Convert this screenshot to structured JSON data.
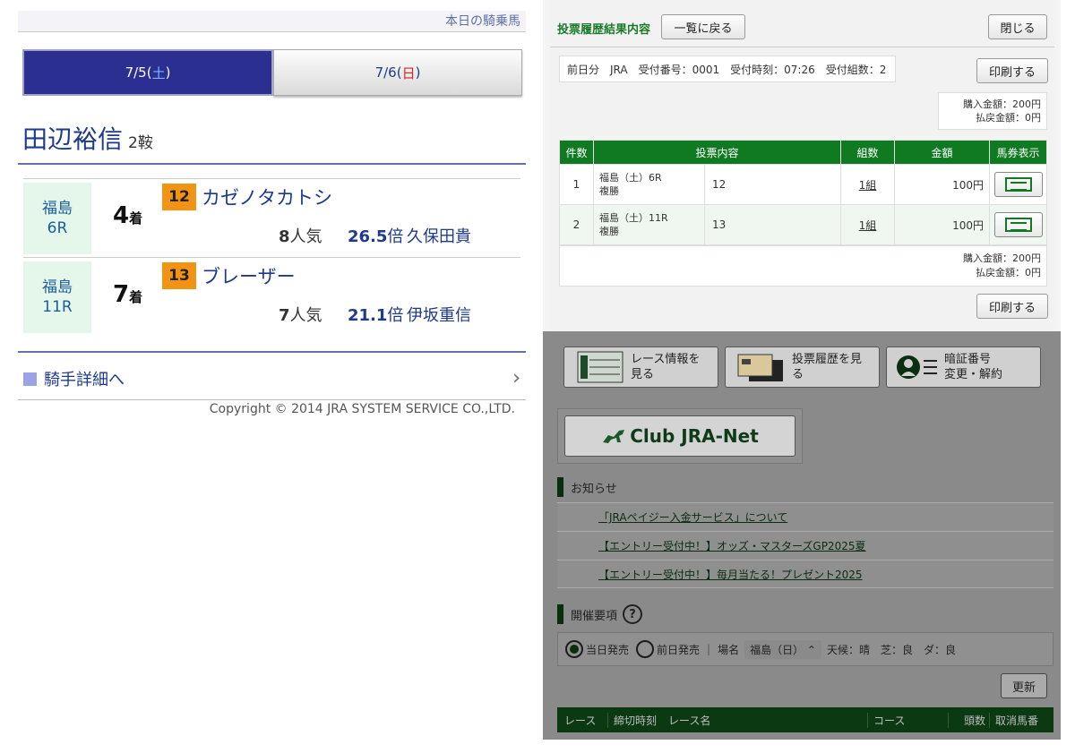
{
  "left": {
    "top_link": "本日の騎乗馬",
    "tabs": [
      {
        "date": "7/5(",
        "day": "土",
        "close": ")",
        "active": true
      },
      {
        "date": "7/6(",
        "day": "日",
        "close": ")",
        "active": false
      }
    ],
    "jockey_name": "田辺裕信",
    "ride_count": "2鞍",
    "rides": [
      {
        "venue": "福島",
        "race": "6R",
        "place_num": "4",
        "place_suffix": "着",
        "horse_num": "12",
        "horse": "カゼノタカトシ",
        "pop_num": "8",
        "pop_suffix": "人気",
        "odds_num": "26.5",
        "odds_suffix": "倍",
        "trainer": "久保田貴"
      },
      {
        "venue": "福島",
        "race": "11R",
        "place_num": "7",
        "place_suffix": "着",
        "horse_num": "13",
        "horse": "ブレーザー",
        "pop_num": "7",
        "pop_suffix": "人気",
        "odds_num": "21.1",
        "odds_suffix": "倍",
        "trainer": "伊坂重信"
      }
    ],
    "detail_link": "騎手詳細へ",
    "copyright": "Copyright © 2014 JRA SYSTEM SERVICE CO.,LTD."
  },
  "modal": {
    "title": "投票履歴結果内容",
    "back_button": "一覧に戻る",
    "close_button": "閉じる",
    "info": "前日分　JRA　受付番号：0001　受付時刻：07:26　受付組数：2",
    "print_button": "印刷する",
    "purchase": "購入金額：200円",
    "refund": "払戻金額：0円",
    "table_headers": [
      "件数",
      "投票内容",
      "組数",
      "金額",
      "馬券表示"
    ],
    "rows": [
      {
        "no": "1",
        "race": "福島（土）6R",
        "type": "複勝",
        "horse": "12",
        "kumi": "1組",
        "amount": "100円"
      },
      {
        "no": "2",
        "race": "福島（土）11R",
        "type": "複勝",
        "horse": "13",
        "kumi": "1組",
        "amount": "100円"
      }
    ],
    "bottom_purchase": "購入金額：200円",
    "bottom_refund": "払戻金額：0円",
    "print_button2": "印刷する"
  },
  "background": {
    "nav": [
      {
        "label1": "レース情報を",
        "label2": "見る"
      },
      {
        "label1": "投票履歴を見",
        "label2": "る"
      },
      {
        "label1": "暗証番号",
        "label2": "変更・解約"
      }
    ],
    "club_label": "Club JRA-Net",
    "news_heading": "お知らせ",
    "news": [
      "「JRAペイジー入金サービス」について",
      "【エントリー受付中！】オッズ・マスターズGP2025夏",
      "【エントリー受付中！】毎月当たる！プレゼント2025"
    ],
    "kaisai_heading": "開催要項",
    "help_label": "?",
    "radio_today": "当日発売",
    "radio_prev": "前日発売",
    "place_label": "場名",
    "place_value": "福島（日）",
    "weather": "天候：晴　芝：良　ダ：良",
    "update_button": "更新",
    "race_headers": [
      "レース",
      "締切時刻",
      "レース名",
      "コース",
      "頭数",
      "取消馬番"
    ]
  },
  "colors": {
    "accent_green": "#0f7a22",
    "tab_blue": "#2b2f91",
    "link_blue": "#1e3a8a",
    "number_orange": "#f39313"
  }
}
